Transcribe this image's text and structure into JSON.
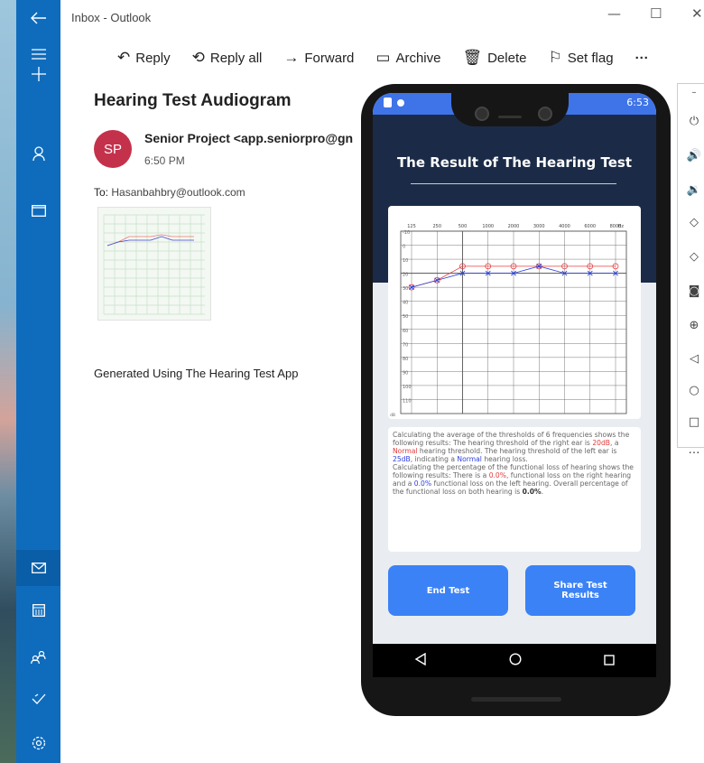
{
  "window": {
    "title": "Inbox - Outlook"
  },
  "toolbar": {
    "reply": "Reply",
    "reply_all": "Reply all",
    "forward": "Forward",
    "archive": "Archive",
    "delete": "Delete",
    "set_flag": "Set flag",
    "more": "···"
  },
  "email": {
    "subject": "Hearing Test Audiogram",
    "avatar_initials": "SP",
    "sender": "Senior Project <app.seniorpro@gn",
    "time": "6:50 PM",
    "to_label": "To:",
    "to_address": "Hasanbahbry@outlook.com",
    "body": "Generated Using The Hearing Test App"
  },
  "phone": {
    "status_time": "6:53",
    "title": "The Result of The Hearing Test",
    "result": {
      "p1": "Calculating the average of the thresholds of 6 frequencies shows the following results: The hearing threshold of the right ear is ",
      "right_db": "20dB",
      "p2": ", a ",
      "right_class": "Normal",
      "p3": " hearing threshold. The hearing threshold of the left ear is ",
      "left_db": "25dB",
      "p4": ", indicating a ",
      "left_class": "Normal",
      "p5": " hearing loss.",
      "p6": "Calculating the percentage of the functional loss of hearing shows the following results: There is a ",
      "right_loss": "0.0%",
      "p7": ", functional loss on the right hearing and a ",
      "left_loss": "0.0%",
      "p8": " functional loss on the left hearing. Overall percentage of the functional loss on both hearing is ",
      "overall_loss": "0.0%",
      "p9": "."
    },
    "buttons": {
      "end": "End Test",
      "share_line1": "Share Test",
      "share_line2": "Results"
    }
  },
  "chart_data": {
    "type": "line",
    "x": [
      "125",
      "250",
      "500",
      "1000",
      "2000",
      "3000",
      "4000",
      "6000",
      "8000"
    ],
    "xunit": "Hz",
    "yunit": "dB",
    "yticks": [
      -10,
      0,
      10,
      20,
      30,
      40,
      50,
      60,
      70,
      80,
      90,
      100,
      110
    ],
    "ylim": [
      -10,
      120
    ],
    "y_inverted": true,
    "grid": true,
    "series": [
      {
        "marker": "circle",
        "color": "#e84040",
        "values": [
          30,
          25,
          15,
          15,
          15,
          15,
          15,
          15,
          15
        ]
      },
      {
        "marker": "x",
        "color": "#2840d8",
        "values": [
          30,
          25,
          20,
          20,
          20,
          15,
          20,
          20,
          20
        ]
      }
    ]
  },
  "colors": {
    "outlook_blue": "#0f6cbd",
    "avatar": "#c4314b",
    "app_header": "#1b2b47",
    "app_button": "#3b82f6",
    "status_bar": "#3f74e8"
  },
  "icons": {
    "rail": [
      "back-arrow-icon",
      "hamburger-icon",
      "plus-icon",
      "person-icon",
      "folder-icon",
      "mail-icon",
      "calendar-icon",
      "people-icon",
      "checkmark-icon",
      "settings-icon"
    ],
    "emulator": [
      "power-icon",
      "volume-up-icon",
      "volume-down-icon",
      "rotate-left-icon",
      "rotate-right-icon",
      "camera-icon",
      "zoom-icon",
      "back-icon",
      "home-icon",
      "overview-icon",
      "more-icon"
    ]
  }
}
